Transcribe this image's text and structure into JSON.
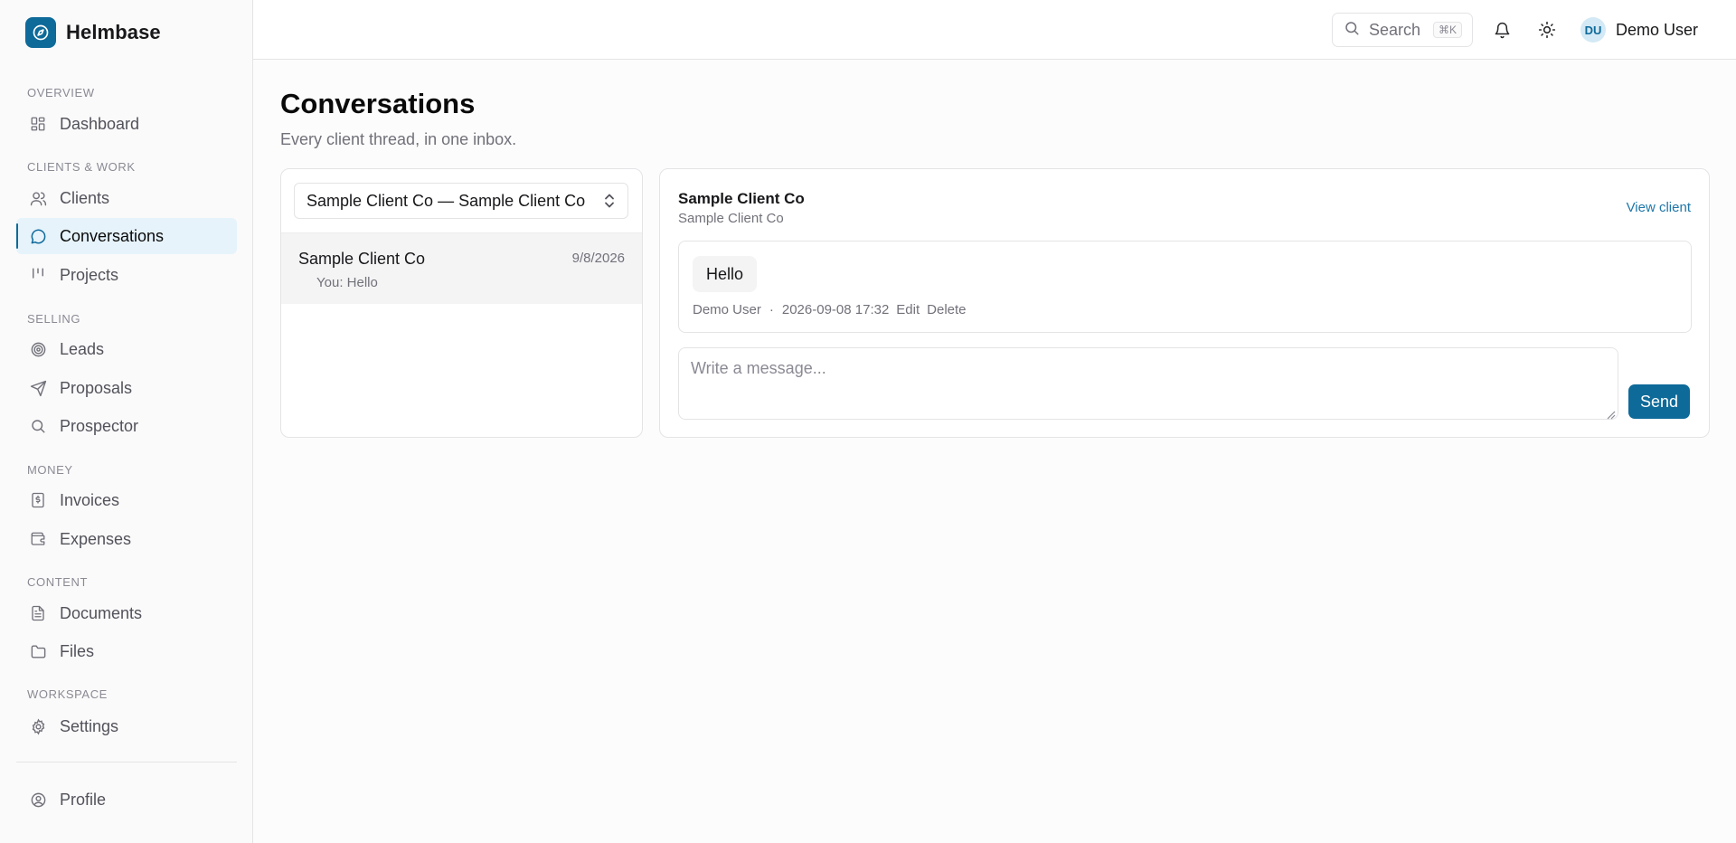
{
  "app": {
    "name": "Helmbase"
  },
  "sidebar": {
    "sections": [
      {
        "label": "OVERVIEW",
        "items": [
          {
            "label": "Dashboard",
            "icon": "dashboard-icon"
          }
        ]
      },
      {
        "label": "CLIENTS & WORK",
        "items": [
          {
            "label": "Clients",
            "icon": "users-icon"
          },
          {
            "label": "Conversations",
            "icon": "message-circle-icon",
            "active": true
          },
          {
            "label": "Projects",
            "icon": "kanban-icon"
          }
        ]
      },
      {
        "label": "SELLING",
        "items": [
          {
            "label": "Leads",
            "icon": "target-icon"
          },
          {
            "label": "Proposals",
            "icon": "send-icon"
          },
          {
            "label": "Prospector",
            "icon": "search-icon"
          }
        ]
      },
      {
        "label": "MONEY",
        "items": [
          {
            "label": "Invoices",
            "icon": "receipt-icon"
          },
          {
            "label": "Expenses",
            "icon": "wallet-icon"
          }
        ]
      },
      {
        "label": "CONTENT",
        "items": [
          {
            "label": "Documents",
            "icon": "file-text-icon"
          },
          {
            "label": "Files",
            "icon": "folder-icon"
          }
        ]
      },
      {
        "label": "WORKSPACE",
        "items": [
          {
            "label": "Settings",
            "icon": "gear-icon"
          }
        ]
      }
    ],
    "footer": {
      "label": "Profile",
      "icon": "user-circle-icon"
    }
  },
  "header": {
    "search": {
      "label": "Search",
      "shortcut": "⌘K"
    },
    "user": {
      "initials": "DU",
      "name": "Demo User"
    }
  },
  "page": {
    "title": "Conversations",
    "subtitle": "Every client thread, in one inbox."
  },
  "threads": {
    "selected_client": "Sample Client Co — Sample Client Co",
    "items": [
      {
        "name": "Sample Client Co",
        "date": "9/8/2026",
        "preview": "You: Hello"
      }
    ]
  },
  "chat": {
    "title": "Sample Client Co",
    "subtitle": "Sample Client Co",
    "view_client_label": "View client",
    "messages": [
      {
        "text": "Hello",
        "author": "Demo User",
        "separator": "·",
        "timestamp": "2026-09-08 17:32",
        "edit_label": "Edit",
        "delete_label": "Delete"
      }
    ],
    "composer": {
      "placeholder": "Write a message...",
      "value": ""
    },
    "send_label": "Send"
  },
  "colors": {
    "accent": "#0e6a99",
    "active_bg": "#e6f3fb",
    "link": "#1f77a8"
  }
}
